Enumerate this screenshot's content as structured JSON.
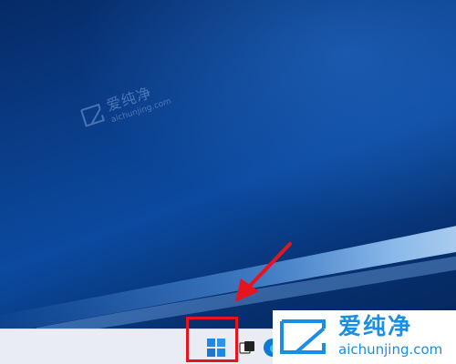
{
  "watermark": {
    "title": "爱纯净",
    "domain": "aichunjing.com"
  },
  "logo": {
    "title": "爱纯净",
    "domain": "aichunjing.com"
  },
  "taskbar": {
    "start_icon": "windows-logo-icon",
    "task_view_icon": "task-view-icon",
    "browser_icon": "edge-icon"
  },
  "colors": {
    "highlight": "#e6141e",
    "taskbar": "#e9edf3",
    "logo_accent": "#1a8ee0",
    "desktop_blue": "#0a3f8c"
  }
}
